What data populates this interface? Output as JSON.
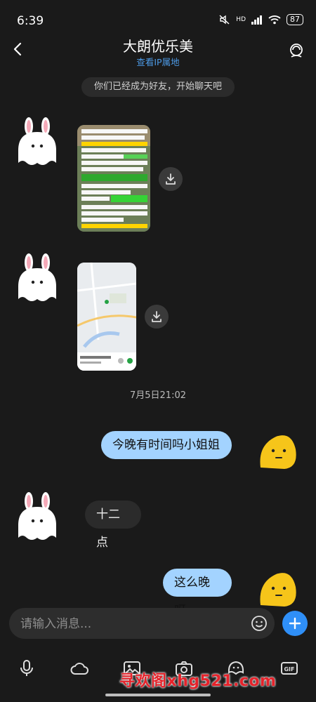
{
  "status_bar": {
    "time": "6:39",
    "network": "HD",
    "battery": "87"
  },
  "header": {
    "title": "大朗优乐美",
    "subtitle": "查看IP属地"
  },
  "system_message": "你们已经成为好友，开始聊天吧",
  "timestamp": "7月5日21:02",
  "messages": [
    {
      "from": "them",
      "type": "image",
      "icon": "download-icon"
    },
    {
      "from": "them",
      "type": "image",
      "icon": "download-icon"
    },
    {
      "from": "me",
      "type": "text",
      "text": "今晚有时间吗小姐姐"
    },
    {
      "from": "them",
      "type": "text",
      "text": "十二点"
    },
    {
      "from": "me",
      "type": "text",
      "text": "这么晚呀"
    }
  ],
  "input": {
    "placeholder": "请输入消息..."
  },
  "toolbar": [
    "mic-icon",
    "cloud-icon",
    "image-icon",
    "camera-icon",
    "emoji-icon",
    "gif-icon"
  ],
  "watermark": "寻欢阁xhg521.com",
  "colors": {
    "background": "#1a1a1a",
    "outgoing_bubble": "#a3d3ff",
    "incoming_bubble": "#2b2b2b",
    "accent": "#2f8ff7",
    "link": "#4d9ae6"
  }
}
